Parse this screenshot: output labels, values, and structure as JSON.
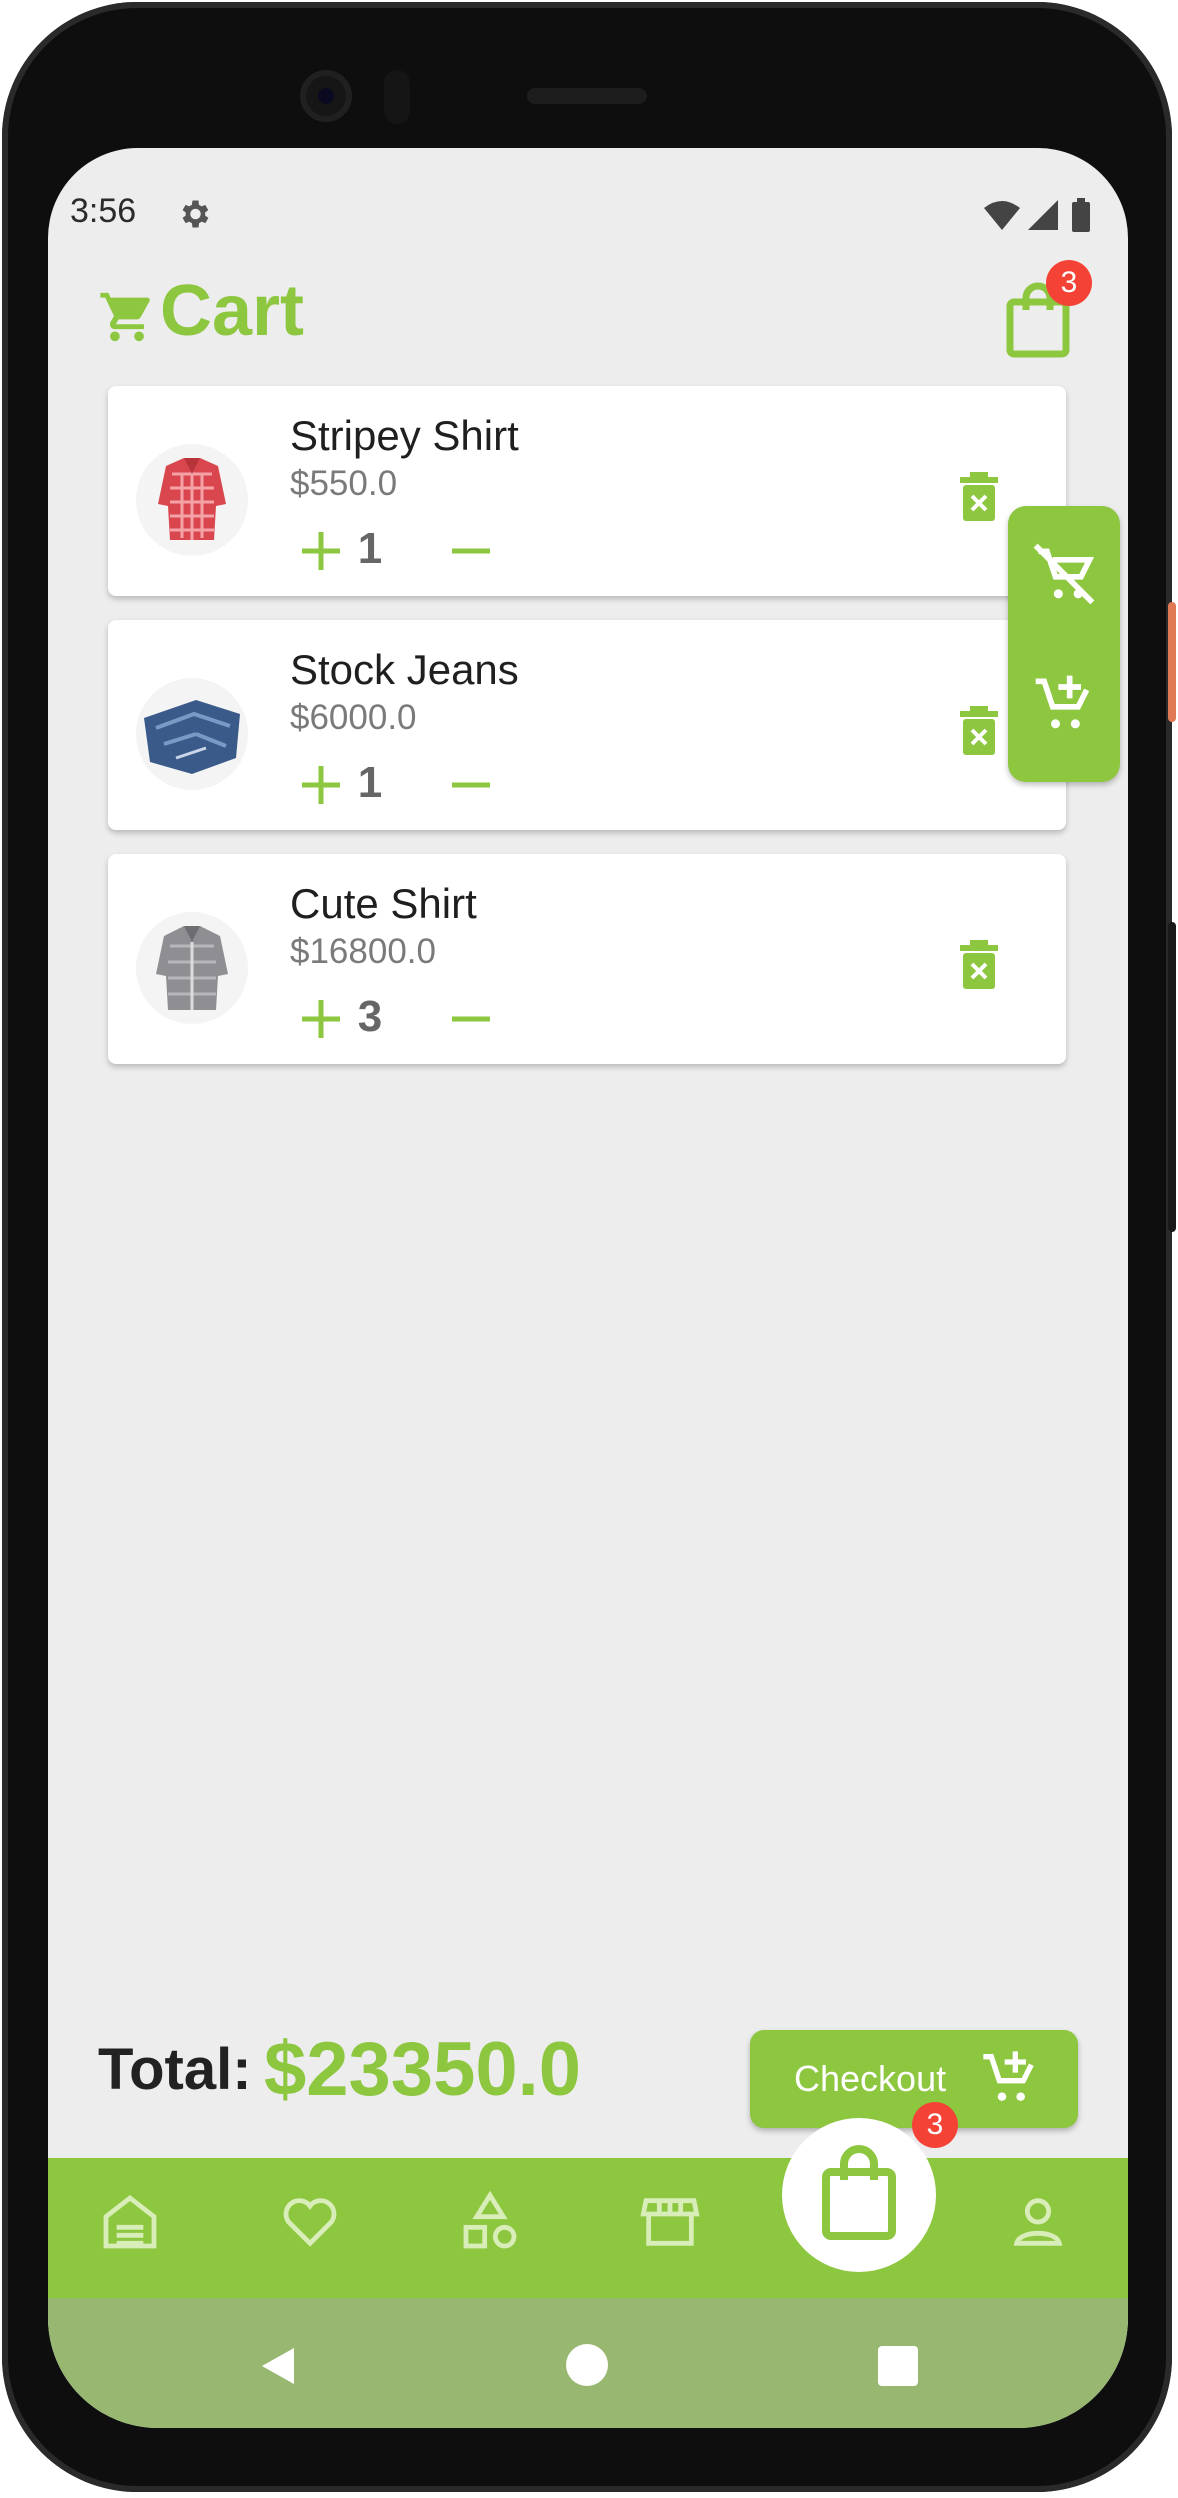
{
  "status_bar": {
    "time": "3:56"
  },
  "header": {
    "title": "Cart",
    "cart_badge": "3"
  },
  "cart": {
    "items": [
      {
        "name": "Stripey Shirt",
        "price": "$550.0",
        "qty": "1"
      },
      {
        "name": "Stock Jeans",
        "price": "$6000.0",
        "qty": "1"
      },
      {
        "name": "Cute Shirt",
        "price": "$16800.0",
        "qty": "3"
      }
    ]
  },
  "footer": {
    "total_label": "Total:",
    "total_value": "$23350.0",
    "checkout_label": "Checkout"
  },
  "bottom_nav": {
    "items": [
      "home",
      "favorites",
      "categories",
      "store",
      "cart",
      "profile"
    ],
    "active": "cart",
    "badge": "3"
  },
  "colors": {
    "accent": "#8dc63f",
    "badge": "#f44336",
    "background": "#ededed",
    "system_nav": "#98b872"
  }
}
